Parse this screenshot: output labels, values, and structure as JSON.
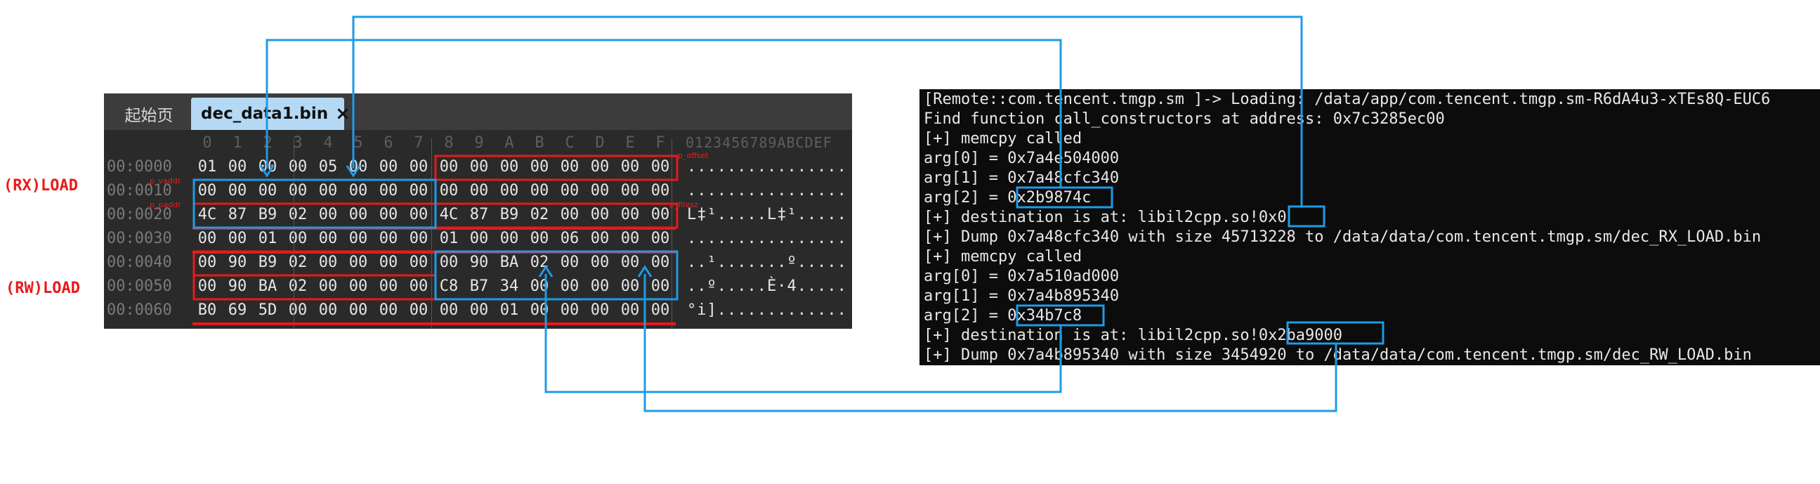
{
  "hex_editor": {
    "tabs": [
      {
        "label": "起始页",
        "active": false
      },
      {
        "label": "dec_data1.bin",
        "active": true
      }
    ],
    "close_glyph": "×",
    "column_headers": [
      "0",
      "1",
      "2",
      "3",
      "4",
      "5",
      "6",
      "7",
      "8",
      "9",
      "A",
      "B",
      "C",
      "D",
      "E",
      "F"
    ],
    "ascii_header": "0123456789ABCDEF",
    "rows": [
      {
        "address": "00:0000",
        "bytes": [
          "01",
          "00",
          "00",
          "00",
          "05",
          "00",
          "00",
          "00",
          "00",
          "00",
          "00",
          "00",
          "00",
          "00",
          "00",
          "00"
        ],
        "ascii": "................"
      },
      {
        "address": "00:0010",
        "bytes": [
          "00",
          "00",
          "00",
          "00",
          "00",
          "00",
          "00",
          "00",
          "00",
          "00",
          "00",
          "00",
          "00",
          "00",
          "00",
          "00"
        ],
        "ascii": "................"
      },
      {
        "address": "00:0020",
        "bytes": [
          "4C",
          "87",
          "B9",
          "02",
          "00",
          "00",
          "00",
          "00",
          "4C",
          "87",
          "B9",
          "02",
          "00",
          "00",
          "00",
          "00"
        ],
        "ascii": "L‡¹.....L‡¹....."
      },
      {
        "address": "00:0030",
        "bytes": [
          "00",
          "00",
          "01",
          "00",
          "00",
          "00",
          "00",
          "00",
          "01",
          "00",
          "00",
          "00",
          "06",
          "00",
          "00",
          "00"
        ],
        "ascii": "................"
      },
      {
        "address": "00:0040",
        "bytes": [
          "00",
          "90",
          "B9",
          "02",
          "00",
          "00",
          "00",
          "00",
          "00",
          "90",
          "BA",
          "02",
          "00",
          "00",
          "00",
          "00"
        ],
        "ascii": "..¹.......º....."
      },
      {
        "address": "00:0050",
        "bytes": [
          "00",
          "90",
          "BA",
          "02",
          "00",
          "00",
          "00",
          "00",
          "C8",
          "B7",
          "34",
          "00",
          "00",
          "00",
          "00",
          "00"
        ],
        "ascii": "..º.....È·4....."
      },
      {
        "address": "00:0060",
        "bytes": [
          "B0",
          "69",
          "5D",
          "00",
          "00",
          "00",
          "00",
          "00",
          "00",
          "00",
          "01",
          "00",
          "00",
          "00",
          "00",
          "00"
        ],
        "ascii": "°i]............."
      }
    ],
    "field_tags": [
      "p_offset",
      "p_vaddr",
      "p_paddr",
      "p_filesz"
    ]
  },
  "side_labels": {
    "rx": "(RX)LOAD",
    "rw": "(RW)LOAD"
  },
  "terminal": {
    "lines": [
      "[Remote::com.tencent.tmgp.sm ]-> Loading: /data/app/com.tencent.tmgp.sm-R6dA4u3-xTEs8Q-EUC6",
      "Find function call_constructors at address: 0x7c3285ec00",
      "[+] memcpy called",
      "arg[0] = 0x7a4e504000",
      "arg[1] = 0x7a48cfc340",
      "arg[2] = 0x2b9874c",
      "[+] destination is at: libil2cpp.so!0x0",
      "[+] Dump 0x7a48cfc340 with size 45713228 to /data/data/com.tencent.tmgp.sm/dec_RX_LOAD.bin",
      "[+] memcpy called",
      "arg[0] = 0x7a510ad000",
      "arg[1] = 0x7a4b895340",
      "arg[2] = 0x34b7c8",
      "[+] destination is at: libil2cpp.so!0x2ba9000",
      "[+] Dump 0x7a4b895340 with size 3454920 to /data/data/com.tencent.tmgp.sm/dec_RW_LOAD.bin"
    ]
  },
  "colors": {
    "annotation_blue": "#1e9be6",
    "annotation_red": "#e81a1a",
    "tab_active": "#b5d9f4",
    "terminal_bg": "#0c0c0c",
    "editor_bg": "#2a2a2a"
  }
}
